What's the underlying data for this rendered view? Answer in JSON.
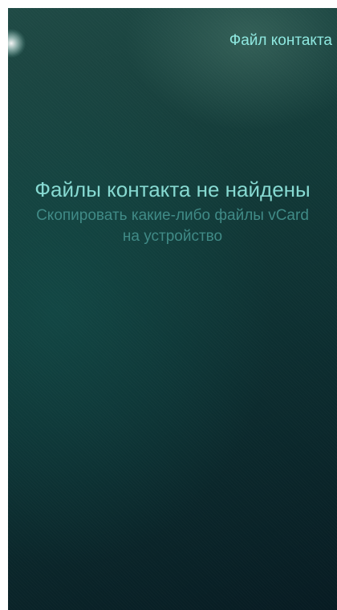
{
  "page": {
    "title": "Файл контакта"
  },
  "placeholder": {
    "text": "Файлы контакта не найдены",
    "hint": "Скопировать какие-либо файлы vCard на устройство"
  },
  "colors": {
    "accent": "#8ee8e0",
    "secondary": "#3f8a86",
    "background": "#0d2f31"
  }
}
